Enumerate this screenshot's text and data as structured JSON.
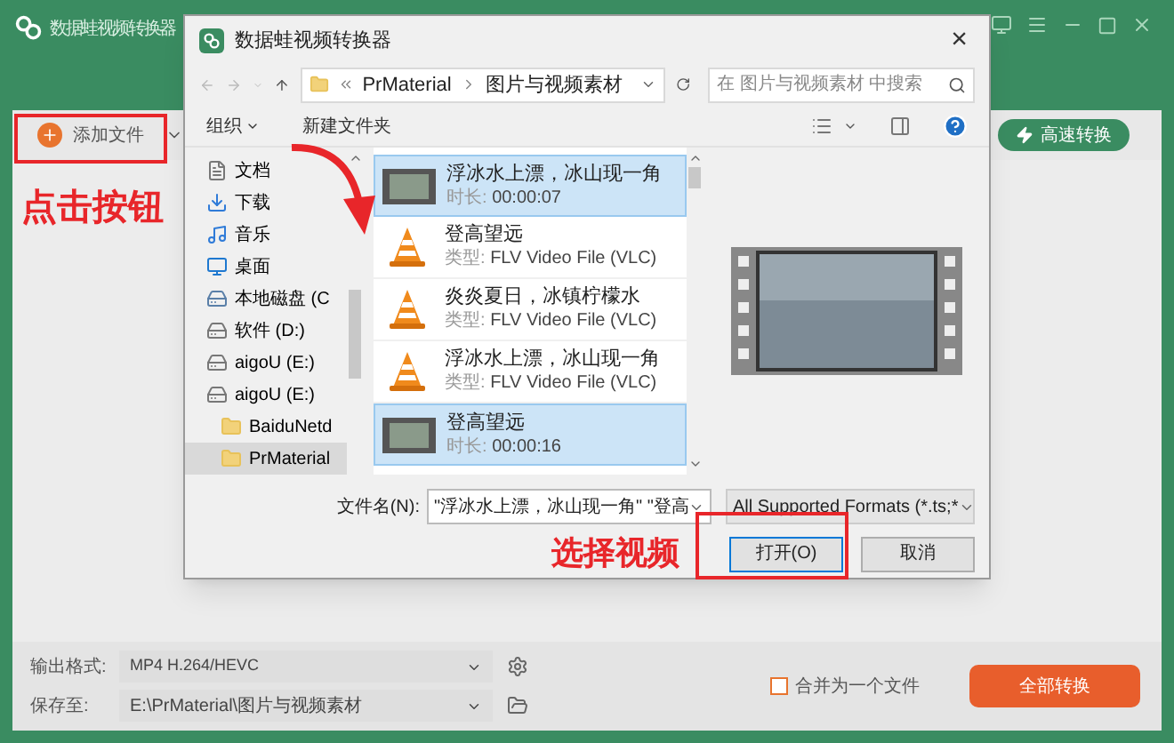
{
  "app": {
    "title": "数据蛙视频转换器",
    "add_file_button": "添加文件",
    "fast_convert_button": "高速转换"
  },
  "dialog": {
    "title": "数据蛙视频转换器",
    "close": "×",
    "breadcrumb": [
      "PrMaterial",
      "图片与视频素材"
    ],
    "search": {
      "placeholder": "在 图片与视频素材 中搜索"
    },
    "toolbar": {
      "organize": "组织",
      "new_folder": "新建文件夹"
    },
    "nav_items": [
      {
        "label": "文档",
        "kind": "document",
        "selected": false
      },
      {
        "label": "下载",
        "kind": "download",
        "selected": false
      },
      {
        "label": "音乐",
        "kind": "music",
        "selected": false
      },
      {
        "label": "桌面",
        "kind": "desktop",
        "selected": false
      },
      {
        "label": "本地磁盘 (C",
        "kind": "disk",
        "selected": false
      },
      {
        "label": "软件 (D:)",
        "kind": "drive",
        "selected": false
      },
      {
        "label": "aigoU (E:)",
        "kind": "drive",
        "selected": false
      },
      {
        "label": "aigoU (E:)",
        "kind": "drive",
        "selected": false,
        "children": [
          {
            "label": "BaiduNetd",
            "kind": "folder",
            "selected": false
          },
          {
            "label": "PrMaterial",
            "kind": "folder",
            "selected": true
          }
        ]
      }
    ],
    "files": [
      {
        "name": "浮冰水上漂，冰山现一角",
        "kind": "video",
        "detail_label": "时长:",
        "detail_value": "00:00:07",
        "selected": true
      },
      {
        "name": "登高望远",
        "kind": "vlc",
        "detail_label": "类型:",
        "detail_value": "FLV Video File (VLC)",
        "selected": false
      },
      {
        "name": "炎炎夏日，冰镇柠檬水",
        "kind": "vlc",
        "detail_label": "类型:",
        "detail_value": "FLV Video File (VLC)",
        "selected": false
      },
      {
        "name": "浮冰水上漂，冰山现一角",
        "kind": "vlc",
        "detail_label": "类型:",
        "detail_value": "FLV Video File (VLC)",
        "selected": false
      },
      {
        "name": "登高望远",
        "kind": "video",
        "detail_label": "时长:",
        "detail_value": "00:00:16",
        "selected": true
      }
    ],
    "file_name_label": "文件名(N):",
    "file_name_value": "\"浮冰水上漂，冰山现一角\" \"登高",
    "file_type": "All Supported Formats (*.ts;*",
    "open_button": "打开(O)",
    "cancel_button": "取消"
  },
  "bottom_bar": {
    "output_format_label": "输出格式:",
    "output_format_value": "MP4 H.264/HEVC",
    "save_to_label": "保存至:",
    "save_to_value": "E:\\PrMaterial\\图片与视频素材",
    "merge_checkbox": {
      "label": "合并为一个文件",
      "checked": false
    },
    "convert_all_button": "全部转换"
  },
  "annotations": {
    "click_button": "点击按钮",
    "select_video": "选择视频"
  }
}
